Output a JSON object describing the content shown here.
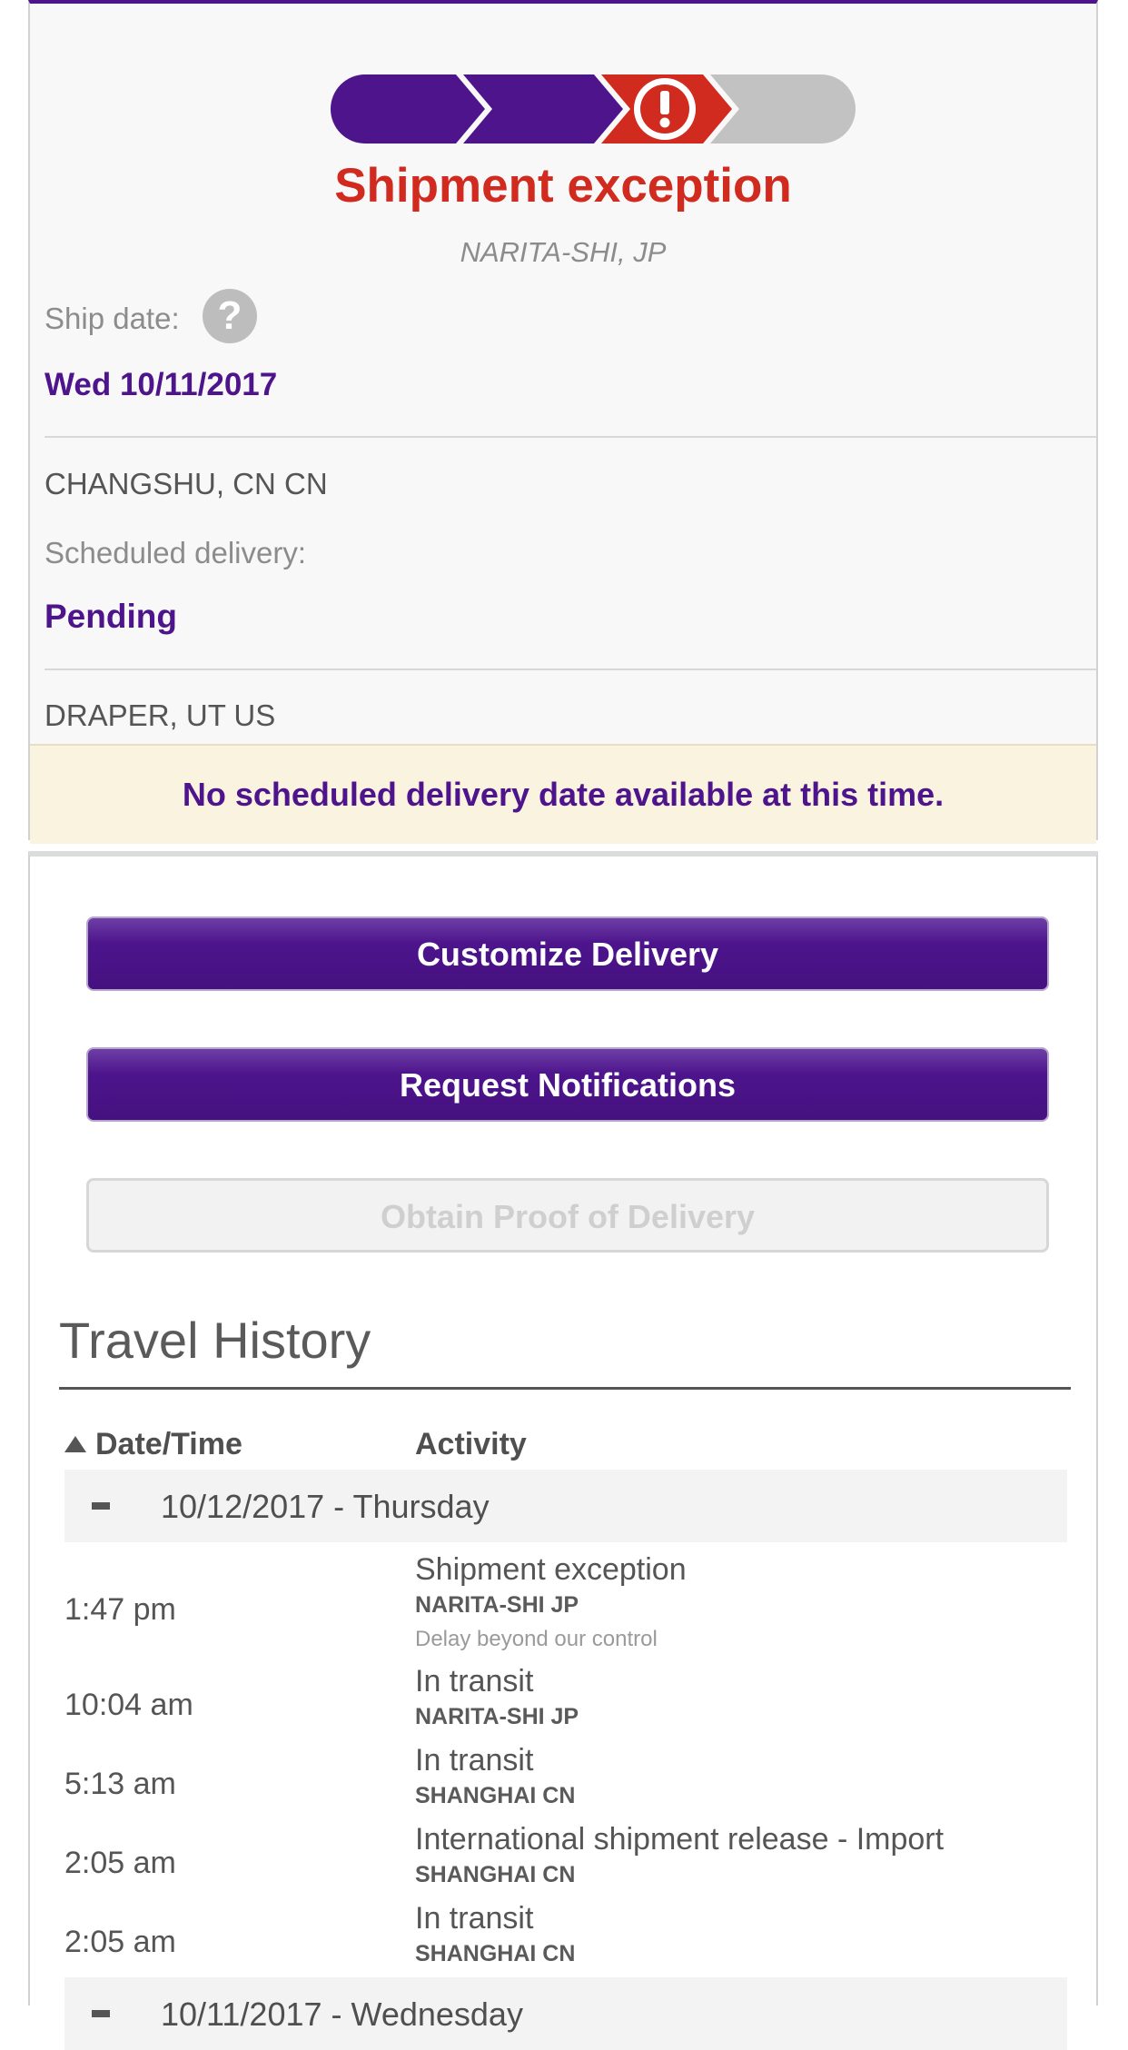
{
  "status": {
    "title": "Shipment exception",
    "location": "NARITA-SHI, JP",
    "progress_steps": [
      "complete",
      "complete",
      "exception",
      "pending"
    ],
    "colors": {
      "complete": "#4d148c",
      "exception": "#d12a1f",
      "pending": "#c2c2c2"
    }
  },
  "ship": {
    "label": "Ship date:",
    "help_icon": "question-mark-icon",
    "date": "Wed 10/11/2017"
  },
  "origin": "CHANGSHU, CN CN",
  "scheduled": {
    "label": "Scheduled delivery:",
    "value": "Pending"
  },
  "destination": "DRAPER, UT US",
  "notice": "No scheduled delivery date available at this time.",
  "buttons": {
    "customize": "Customize Delivery",
    "notifications": "Request Notifications",
    "proof": "Obtain Proof of Delivery"
  },
  "travel_history": {
    "title": "Travel History",
    "col_date": "Date/Time",
    "col_activity": "Activity",
    "days": [
      {
        "label": "10/12/2017 - Thursday",
        "toggle": "-",
        "events": [
          {
            "time": "1:47 pm",
            "activity": "Shipment exception",
            "location": "NARITA-SHI JP",
            "note": "Delay beyond our control"
          },
          {
            "time": "10:04 am",
            "activity": "In transit",
            "location": "NARITA-SHI JP"
          },
          {
            "time": "5:13 am",
            "activity": "In transit",
            "location": "SHANGHAI CN"
          },
          {
            "time": "2:05 am",
            "activity": "International shipment release - Import",
            "location": "SHANGHAI CN"
          },
          {
            "time": "2:05 am",
            "activity": "In transit",
            "location": "SHANGHAI CN"
          }
        ]
      },
      {
        "label": "10/11/2017 - Wednesday",
        "toggle": "-"
      }
    ]
  }
}
